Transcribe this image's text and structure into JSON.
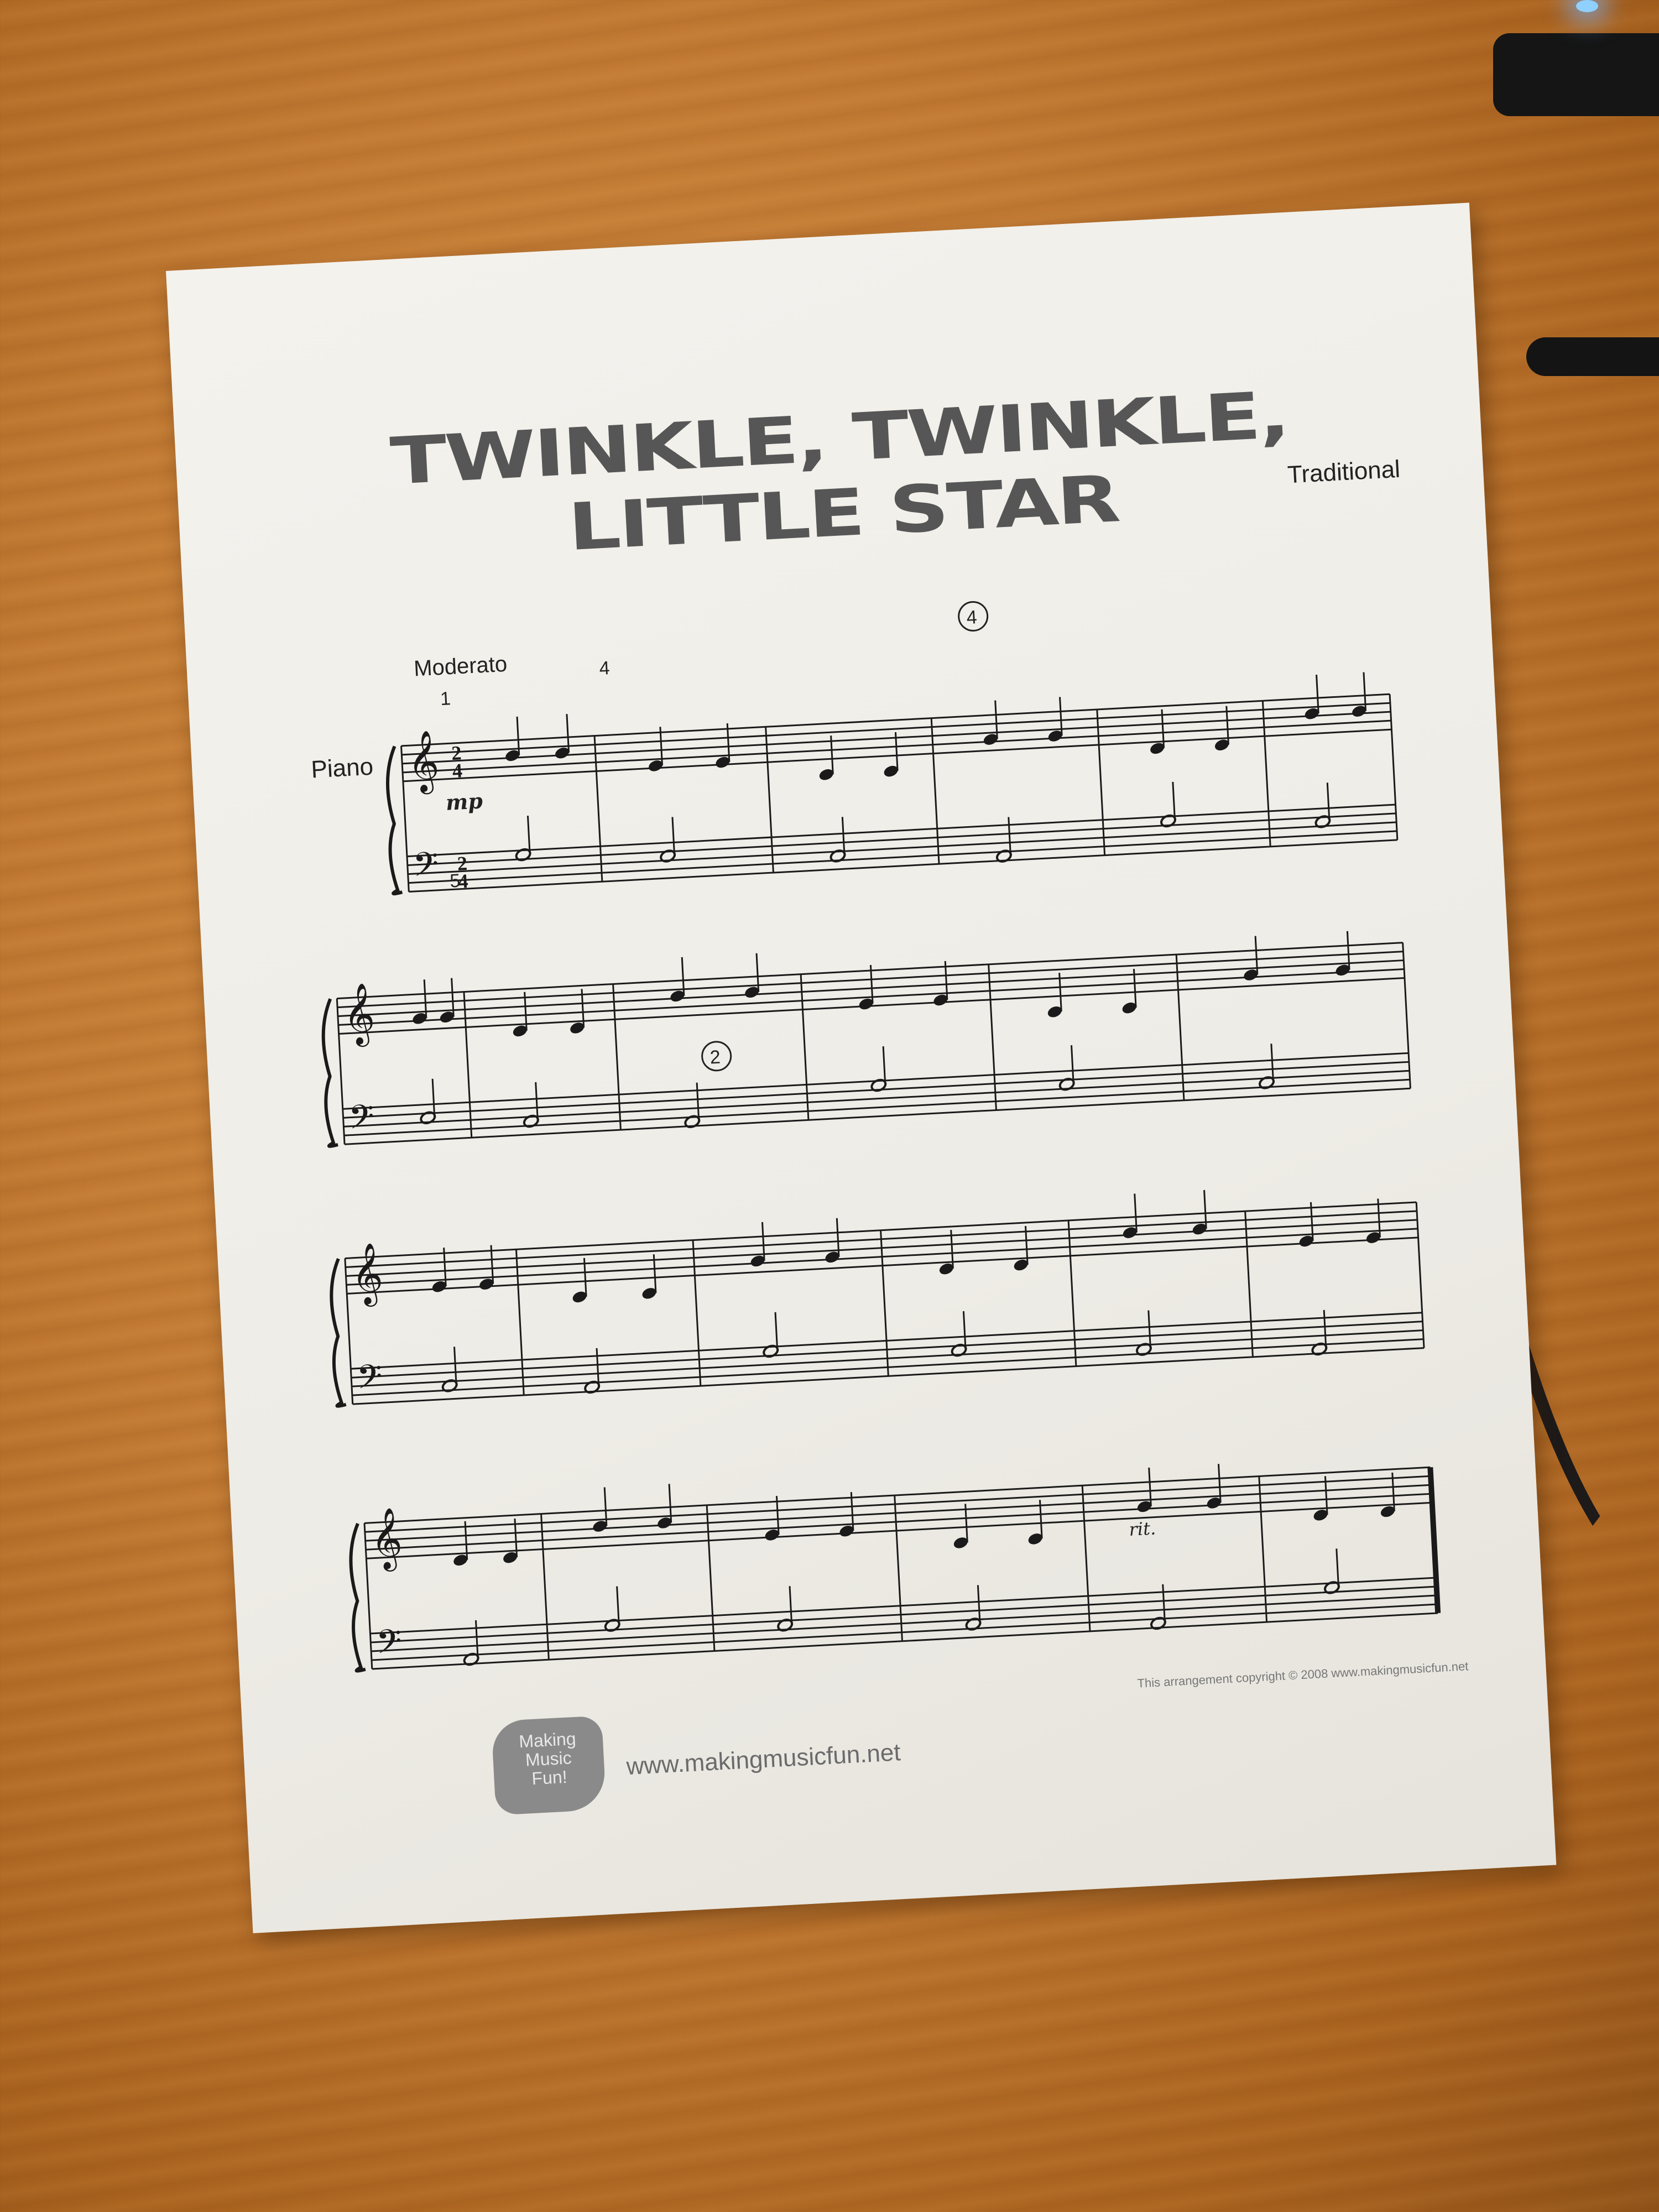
{
  "title": "TWINKLE, TWINKLE, LITTLE STAR",
  "composer": "Traditional",
  "tempo_marking": "Moderato",
  "instrument": "Piano",
  "dynamic": "mp",
  "ritardando": "rit.",
  "fingerings": {
    "treble_first": "1",
    "treble_bar2": "4",
    "bass_first": "5",
    "circled_top": "4",
    "circled_bass": "2"
  },
  "website": "www.makingmusicfun.net",
  "logo_text": [
    "Making",
    "Music",
    "Fun!"
  ],
  "copyright": "This arrangement copyright © 2008 www.makingmusicfun.net",
  "time_signature": [
    "2",
    "4"
  ]
}
